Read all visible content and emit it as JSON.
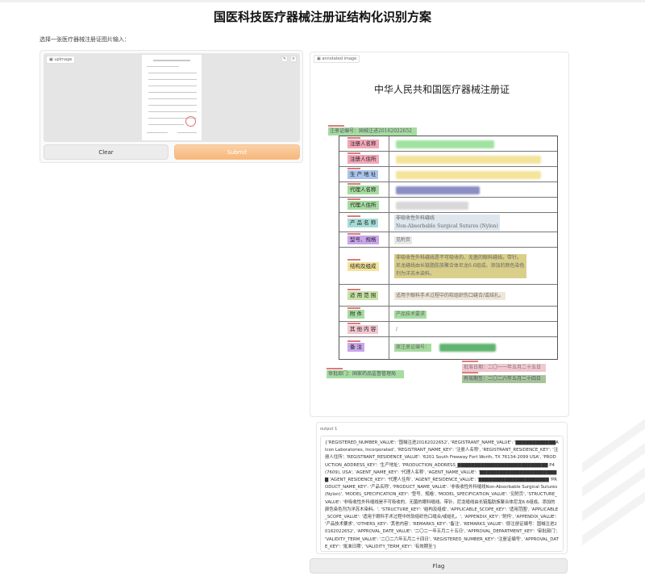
{
  "page": {
    "title": "国医科技医疗器械注册证结构化识别方案",
    "subtitle": "选择一张医疗器械注册证图片输入："
  },
  "input": {
    "tag": "upImage",
    "clear_label": "Clear",
    "submit_label": "Submit",
    "edit_icon": "✎",
    "close_icon": "×"
  },
  "annotated": {
    "tag": "annotated image",
    "doc_title": "中华人民共和国医疗器械注册证",
    "reg_number": "注册证编号：国械注进20162022652",
    "rows": [
      {
        "label": "注册人名称",
        "color": "#f2a7b8",
        "value": ""
      },
      {
        "label": "注册人住所",
        "color": "#f2a7b8",
        "value": ""
      },
      {
        "label": "生 产 地 址",
        "color": "#a9c4ec",
        "value": ""
      },
      {
        "label": "代理人名称",
        "color": "#a6dca0",
        "value": ""
      },
      {
        "label": "代理人住所",
        "color": "#a6dca0",
        "value": ""
      },
      {
        "label": "产 品 名 称",
        "color": "#a6dcd6",
        "value": "非吸收性外科缝线\nNon-Absorbable Surgical Sutures (Nylon)"
      },
      {
        "label": "型号、规格",
        "color": "#c9a6ec",
        "value": "见附页"
      },
      {
        "label": "结构及组成",
        "color": "#f4e39a",
        "value": "非吸收性外科缝线是不可吸收的、无菌的眼科缝线。带针。\n尼龙缝线由长链脂肪族聚合体尼龙6.6组成。添加的颜色染色\n剂为洋苏木染料。"
      },
      {
        "label": "适 用 范 围",
        "color": "#c8e2a6",
        "value": "适用于眼科手术过程中的软组织伤口缝合/或结扎。"
      },
      {
        "label": "附         件",
        "color": "#a6dca0",
        "value": "产品技术要求"
      },
      {
        "label": "其 他 内 容",
        "color": "#f2c7d0",
        "value": "/"
      },
      {
        "label": "备      注",
        "color": "#c9a6ec",
        "value": "原注册证编号："
      }
    ],
    "approval_date": "批准日期：二〇一一年五月二十五日",
    "dept": "审批部门：国家药品监督管理局",
    "validity": "有效期至：二〇二六年五月二十四日"
  },
  "output": {
    "label": "output 1",
    "text": "{'REGISTERED_NUMBER_VALUE': '国械注进20162022652', 'REGISTRANT_NAME_VALUE': '▇▇▇▇▇▇▇▇▇▇▇▇Alcon Laboratories, Incorporated', 'REGISTRANT_NAME_KEY': '注册人名称', 'REGISTRANT_RESIDENCE_KEY': '注册人住所', 'REGISTRANT_RESIDENCE_VALUE': '6201 South Freeway Fort Worth, TX 76134-2099 USA', 'PRODUCTION_ADDRESS_KEY': '生产地址', 'PRODUCTION_ADDRESS_▇▇▇▇▇▇▇▇▇▇▇▇▇▇▇▇▇▇▇▇▇▇▇▇▇▇▇ P4 (7609), USA', 'AGENT_NAME_KEY': '代理人名称', 'AGENT_NAME_VALUE': '▇▇▇▇▇▇▇▇▇▇▇▇▇▇▇▇▇▇▇▇▇▇▇▇ 'AGENT_RESIDENCE_KEY': '代理人住所', 'AGENT_RESIDENCE_VALUE': '▇▇▇▇▇▇▇▇▇▇▇▇▇▇▇▇▇▇▇▇▇ 'PRODUCT_NAME_KEY': '产品名称', 'PRODUCT_NAME_VALUE': '非吸收性外科缝线Non-Absorbable Surgical Sutures (Nylon)', 'MODEL_SPECIFICATION_KEY': '型号、规格', 'MODEL_SPECIFICATION_VALUE': '见附页', 'STRUCTURE_VALUE': '非吸收性外科缝线是不可吸收的、无菌的眼科缝线。带针。尼龙缝线由长链脂肪族聚合体尼龙6.6组成。添加的颜色染色剂为洋苏木染料。', 'STRUCTURE_KEY': '结构及组成', 'APPLICABLE_SCOPE_KEY': '适用范围', 'APPLICABLE_SCOPE_VALUE': '适用于眼科手术过程中的软组织伤口缝合/或结扎。', 'APPENDIX_KEY': '附件', 'APPENDIX_VALUE': '产品技术要求', 'OTHERS_KEY': '其他内容', 'REMARKS_KEY': '备注', 'REMARKS_VALUE': '原注册证编号：国械注进20162022652', 'APPROVAL_DATE_VALUE': '二〇二一年五月二十五日', 'APPROVAL_DEPARTMENT_KEY': '审批部门', 'VALIDITY_TERM_VALUE': '二〇二六年五月二十四日', 'REGISTERED_NUMBER_KEY': '注册证编号', 'APPROVAL_DATE_KEY': '批准日期', 'VALIDITY_TERM_KEY': '有效期至'}"
  },
  "flag": {
    "label": "Flag"
  }
}
